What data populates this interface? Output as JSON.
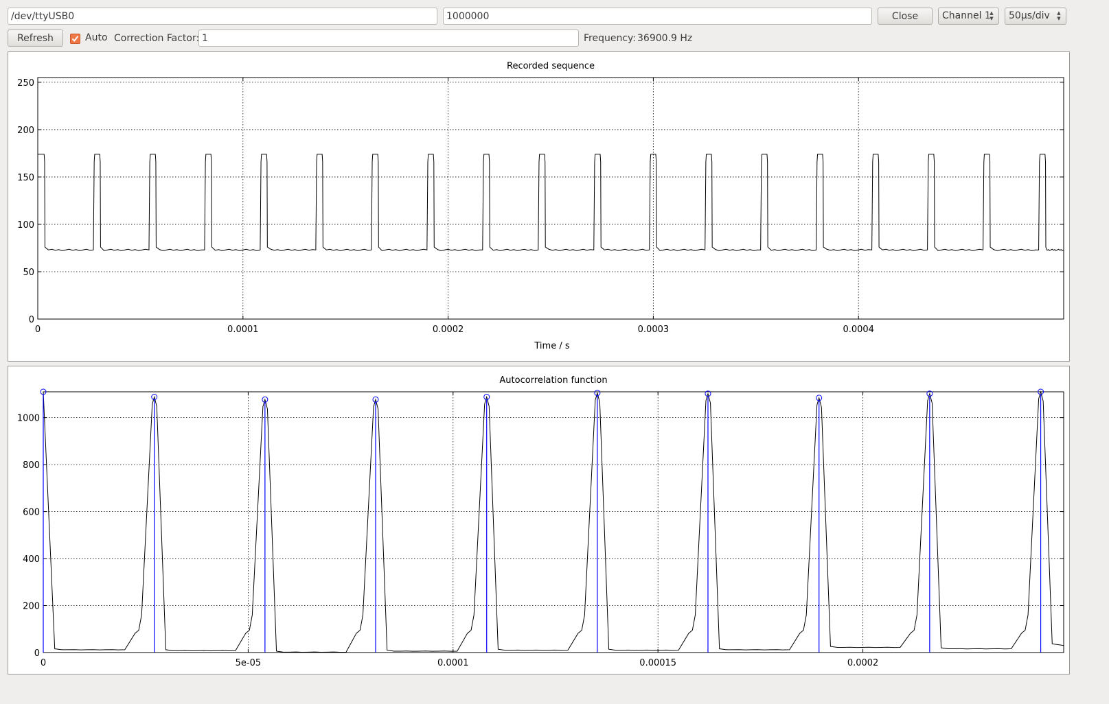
{
  "toolbar": {
    "port_value": "/dev/ttyUSB0",
    "baud_value": "1000000",
    "close_label": "Close",
    "channel_selected": "Channel 1",
    "timebase_selected": "50µs/div",
    "refresh_label": "Refresh",
    "auto_label": "Auto",
    "auto_checked": true,
    "correction_label": "Correction Factor:",
    "correction_value": "1",
    "frequency_label": "Frequency:",
    "frequency_value": "36900.9 Hz"
  },
  "colors": {
    "accent": "#f07746",
    "trace": "#000000",
    "peak_marker": "#0000ff"
  },
  "chart_data": [
    {
      "type": "line",
      "title": "Recorded sequence",
      "xlabel": "Time / s",
      "ylabel": "",
      "xlim": [
        0,
        0.0005
      ],
      "ylim": [
        0,
        255
      ],
      "xticks": [
        "0",
        "0.0001",
        "0.0002",
        "0.0003",
        "0.0004"
      ],
      "xtick_values": [
        0,
        0.0001,
        0.0002,
        0.0003,
        0.0004
      ],
      "yticks": [
        "0",
        "50",
        "100",
        "150",
        "200",
        "250"
      ],
      "ytick_values": [
        0,
        50,
        100,
        150,
        200,
        250
      ],
      "grid": true,
      "signal": {
        "low_level": 73,
        "high_level": 174,
        "pulse_width": 3.5e-06,
        "pulse_starts": [
          0,
          2.71e-05,
          5.42e-05,
          8.13e-05,
          0.0001084,
          0.0001355,
          0.0001626,
          0.0001897,
          0.0002168,
          0.0002439,
          0.000271,
          0.0002981,
          0.0003252,
          0.0003523,
          0.0003794,
          0.0004065,
          0.0004336,
          0.0004607,
          0.0004878
        ]
      }
    },
    {
      "type": "line",
      "title": "Autocorrelation function",
      "xlabel": "",
      "ylabel": "",
      "xlim": [
        0,
        0.000249
      ],
      "ylim": [
        0,
        1110
      ],
      "xticks": [
        "0",
        "5e-05",
        "0.0001",
        "0.00015",
        "0.0002"
      ],
      "xtick_values": [
        0,
        5e-05,
        0.0001,
        0.00015,
        0.0002
      ],
      "yticks": [
        "0",
        "200",
        "400",
        "600",
        "800",
        "1000"
      ],
      "ytick_values": [
        0,
        200,
        400,
        600,
        800,
        1000
      ],
      "grid": true,
      "peaks": [
        {
          "x": 0,
          "y": 1110
        },
        {
          "x": 2.71e-05,
          "y": 1088
        },
        {
          "x": 5.41e-05,
          "y": 1077
        },
        {
          "x": 8.11e-05,
          "y": 1077
        },
        {
          "x": 0.0001082,
          "y": 1088
        },
        {
          "x": 0.0001352,
          "y": 1105
        },
        {
          "x": 0.0001622,
          "y": 1102
        },
        {
          "x": 0.0001893,
          "y": 1084
        },
        {
          "x": 0.0002163,
          "y": 1102
        },
        {
          "x": 0.0002434,
          "y": 1110
        }
      ],
      "baseline_levels": [
        12,
        8,
        2,
        6,
        10,
        10,
        12,
        22,
        16,
        33,
        30
      ]
    }
  ]
}
